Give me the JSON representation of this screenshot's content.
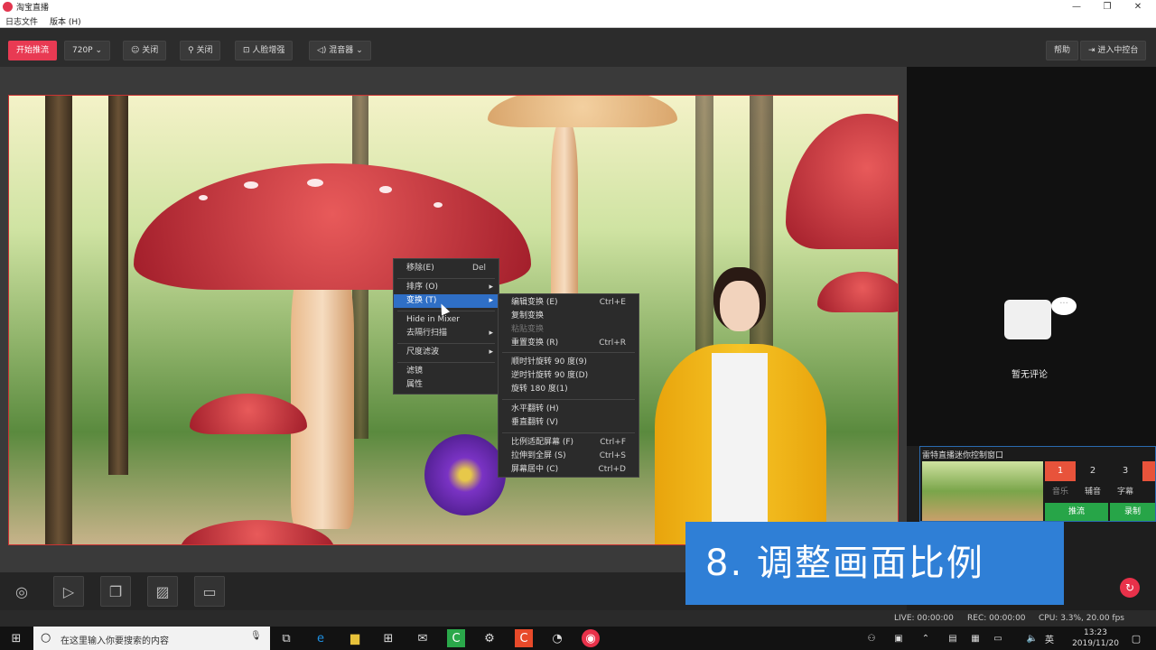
{
  "window": {
    "title": "淘宝直播",
    "minimize": "—",
    "maximize": "❐",
    "close": "✕"
  },
  "menubar": {
    "items": [
      "日志文件",
      "版本 (H)"
    ]
  },
  "toolbar": {
    "start_stream": "开始推流",
    "resolution": "720P",
    "beauty_label": "关闭",
    "filter_label": "关闭",
    "face_enhance": "人脸增强",
    "mixer": "混音器",
    "help": "帮助",
    "enter_console": "进入中控台"
  },
  "context_menu": {
    "items": [
      {
        "label": "移除(E)",
        "shortcut": "Del"
      },
      {
        "label": "排序 (O)",
        "arrow": "▸"
      },
      {
        "label": "变换 (T)",
        "arrow": "▸"
      },
      {
        "label": "Hide in Mixer"
      },
      {
        "label": "去隔行扫描",
        "arrow": "▸"
      },
      {
        "label": "尺度滤波",
        "arrow": "▸"
      },
      {
        "label": "滤镜"
      },
      {
        "label": "属性"
      }
    ]
  },
  "submenu": {
    "items": [
      {
        "label": "编辑变换 (E)",
        "shortcut": "Ctrl+E"
      },
      {
        "label": "复制变换",
        "shortcut": ""
      },
      {
        "label": "粘贴变换",
        "shortcut": ""
      },
      {
        "label": "重置变换 (R)",
        "shortcut": "Ctrl+R"
      },
      {
        "label": "顺时针旋转 90 度(9)",
        "shortcut": ""
      },
      {
        "label": "逆时针旋转 90 度(D)",
        "shortcut": ""
      },
      {
        "label": "旋转 180 度(1)",
        "shortcut": ""
      },
      {
        "label": "水平翻转 (H)",
        "shortcut": ""
      },
      {
        "label": "垂直翻转 (V)",
        "shortcut": ""
      },
      {
        "label": "比例适配屏幕 (F)",
        "shortcut": "Ctrl+F"
      },
      {
        "label": "拉伸到全屏 (S)",
        "shortcut": "Ctrl+S"
      },
      {
        "label": "屏幕居中 (C)",
        "shortcut": "Ctrl+D"
      }
    ]
  },
  "right_panel": {
    "no_comments": "暂无评论"
  },
  "mini_console": {
    "title": "雷特直播迷你控制窗口",
    "numbers": [
      "1",
      "2",
      "3"
    ],
    "labels": [
      "音乐",
      "辅音",
      "字幕"
    ],
    "push": "推流",
    "record": "录制"
  },
  "status": {
    "live": "LIVE: 00:00:00",
    "rec": "REC: 00:00:00",
    "cpu": "CPU: 3.3%, 20.00 fps"
  },
  "caption": "8. 调整画面比例",
  "taskbar": {
    "search_placeholder": "在这里输入你要搜索的内容",
    "ime": "英",
    "time": "13:23",
    "date": "2019/11/20"
  }
}
